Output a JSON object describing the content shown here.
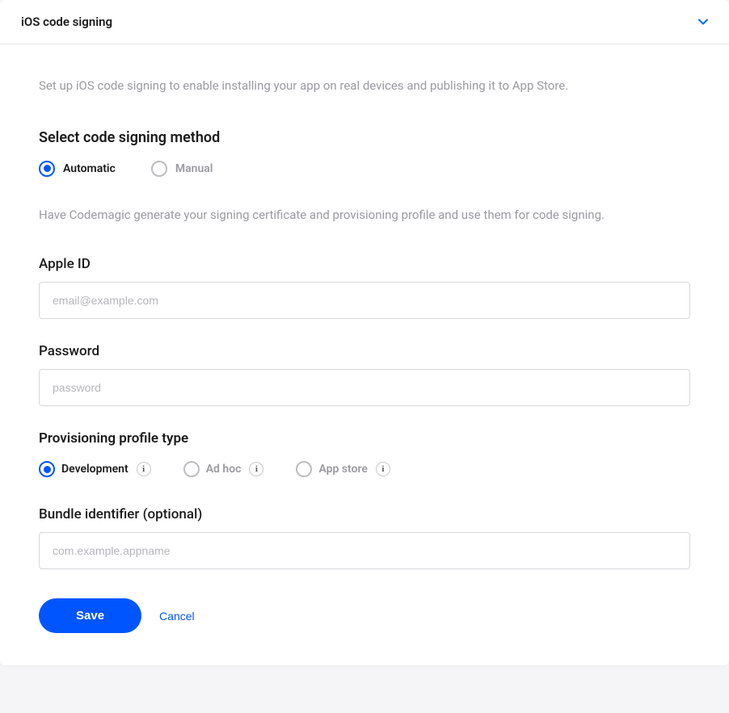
{
  "header": {
    "title": "iOS code signing"
  },
  "intro": "Set up iOS code signing to enable installing your app on real devices and publishing it to App Store.",
  "method": {
    "heading": "Select code signing method",
    "options": {
      "automatic": "Automatic",
      "manual": "Manual"
    },
    "description": "Have Codemagic generate your signing certificate and provisioning profile and use them for code signing."
  },
  "fields": {
    "apple_id": {
      "label": "Apple ID",
      "placeholder": "email@example.com"
    },
    "password": {
      "label": "Password",
      "placeholder": "password"
    },
    "bundle_id": {
      "label": "Bundle identifier (optional)",
      "placeholder": "com.example.appname"
    }
  },
  "profile": {
    "heading": "Provisioning profile type",
    "options": {
      "development": "Development",
      "adhoc": "Ad hoc",
      "appstore": "App store"
    }
  },
  "actions": {
    "save": "Save",
    "cancel": "Cancel"
  },
  "info_glyph": "i"
}
